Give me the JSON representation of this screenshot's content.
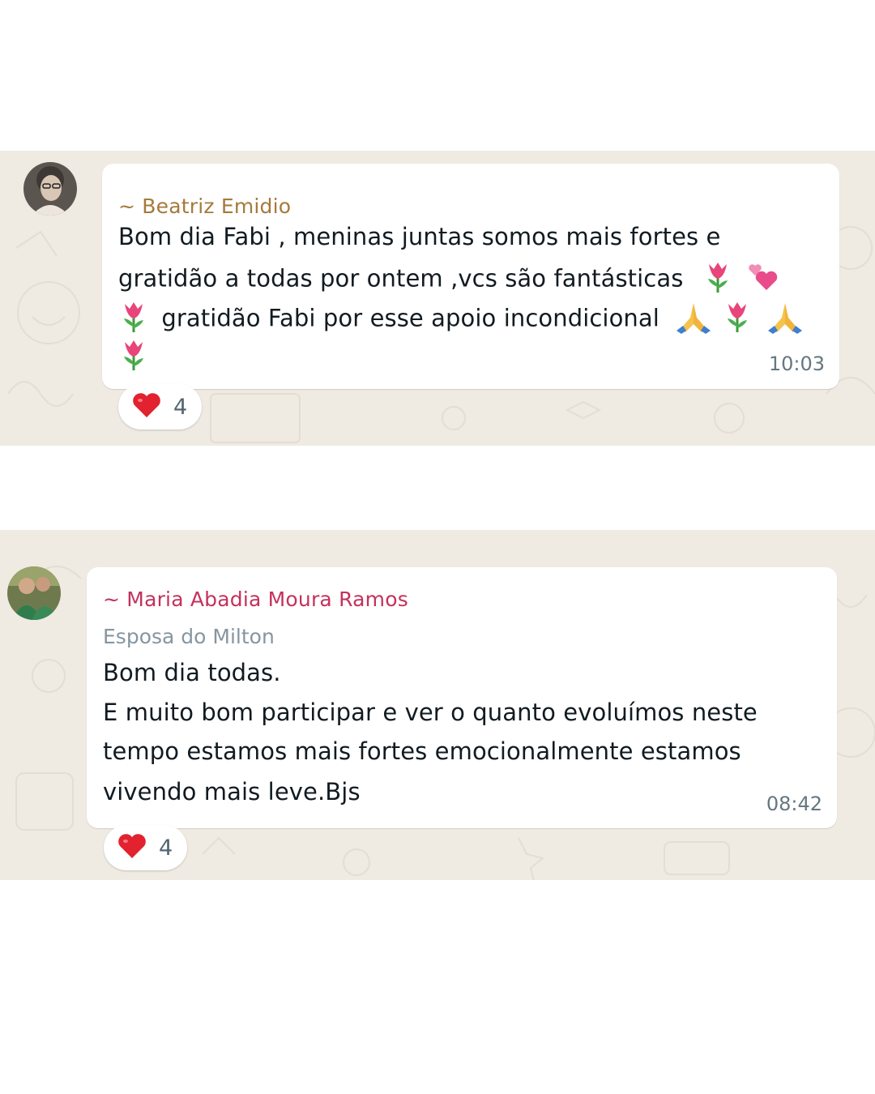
{
  "messages": [
    {
      "sender": "~ Beatriz Emidio",
      "sender_color": "#a57a3c",
      "lines": [
        "Bom dia Fabi , meninas juntas somos mais fortes e",
        "gratidão a todas por ontem ,vcs são fantásticas",
        "gratidão Fabi por esse apoio incondicional"
      ],
      "time": "10:03",
      "reaction": {
        "icon": "red-heart-icon",
        "count": "4"
      },
      "emojis": [
        "tulip-icon",
        "revolving-hearts-icon",
        "folded-hands-icon"
      ]
    },
    {
      "sender": "~ Maria Abadia Moura Ramos",
      "sender_color": "#c4315d",
      "subtitle": "Esposa do Milton",
      "lines": [
        "Bom dia  todas.",
        "E muito bom participar e ver o quanto evoluímos neste",
        "tempo estamos mais fortes emocionalmente estamos",
        "vivendo mais leve.Bjs"
      ],
      "time": "08:42",
      "reaction": {
        "icon": "red-heart-icon",
        "count": "4"
      }
    }
  ],
  "colors": {
    "chat_background": "#efeae2",
    "bubble": "#ffffff",
    "timestamp": "#667781",
    "subtitle": "#8696a0"
  }
}
